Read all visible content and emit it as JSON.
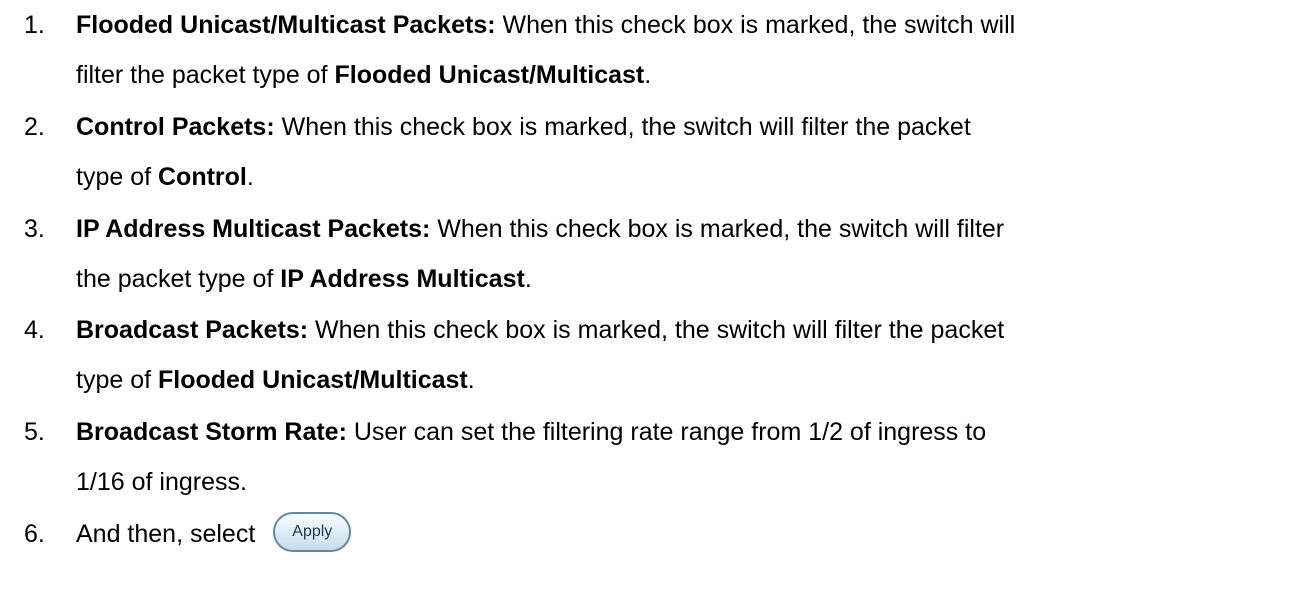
{
  "items": [
    {
      "number": "1.",
      "line1": {
        "bold1": "Flooded Unicast/Multicast Packets:",
        "text1": " When this check box is marked, the switch will"
      },
      "line2": {
        "text1": "filter the packet type of ",
        "bold1": "Flooded Unicast/Multicast",
        "text2": "."
      }
    },
    {
      "number": "2.",
      "line1": {
        "bold1": "Control Packets:",
        "text1": " When this check box is marked, the switch will filter the packet"
      },
      "line2": {
        "text1": "type of ",
        "bold1": "Control",
        "text2": "."
      }
    },
    {
      "number": "3.",
      "line1": {
        "bold1": "IP Address Multicast Packets:",
        "text1": " When this check box is marked, the switch will filter"
      },
      "line2": {
        "text1": "the packet type of ",
        "bold1": "IP Address Multicast",
        "text2": "."
      }
    },
    {
      "number": "4.",
      "line1": {
        "bold1": "Broadcast Packets:",
        "text1": " When this check box is marked, the switch will filter the packet"
      },
      "line2": {
        "text1": "type of ",
        "bold1": "Flooded Unicast/Multicast",
        "text2": "."
      }
    },
    {
      "number": "5.",
      "line1": {
        "bold1": "Broadcast Storm Rate:",
        "text1": " User can set the filtering rate range from 1/2 of ingress to"
      },
      "line2": {
        "text1": "1/16 of ingress."
      }
    },
    {
      "number": "6.",
      "line1": {
        "text1": "And then, select"
      },
      "apply_button_label": "Apply"
    }
  ]
}
